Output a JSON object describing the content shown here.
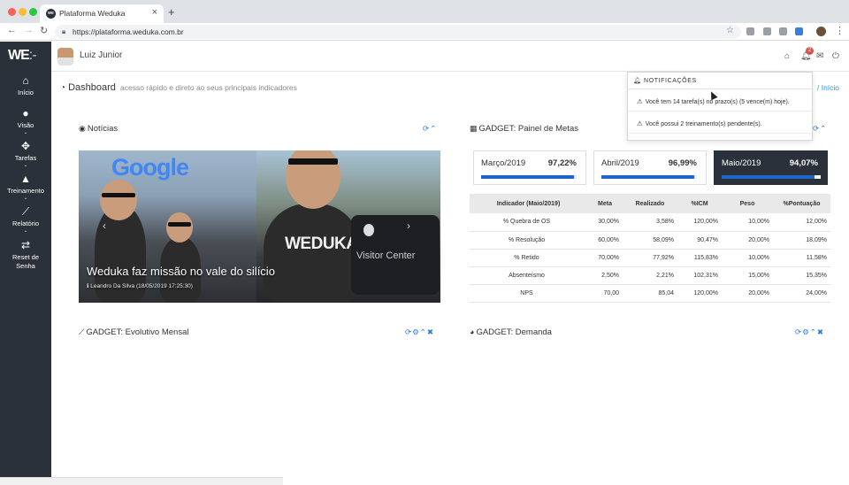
{
  "browser": {
    "tab_title": "Plataforma Weduka",
    "tab_favicon": "we",
    "new_tab": "+",
    "url": "https://plataforma.weduka.com.br"
  },
  "sidebar": {
    "logo": "WE",
    "logo_suffix": ":-",
    "items": [
      {
        "label": "Início",
        "icon": "home-icon",
        "expandable": false
      },
      {
        "label": "Visão",
        "icon": "user-icon",
        "expandable": true
      },
      {
        "label": "Tarefas",
        "icon": "crosshairs-icon",
        "expandable": true
      },
      {
        "label": "Treinamento",
        "icon": "graduation-cap-icon",
        "expandable": true
      },
      {
        "label": "Relatório",
        "icon": "line-chart-icon",
        "expandable": true
      },
      {
        "label": "Reset de Senha",
        "icon": "exchange-icon",
        "expandable": false
      }
    ]
  },
  "topbar": {
    "username": "Luiz Junior",
    "notification_count": "2"
  },
  "header": {
    "title": "Dashboard",
    "subtitle": "acesso rápido e direto ao seus principais indicadores",
    "breadcrumb": "/ Início"
  },
  "notifications": {
    "title": "NOTIFICAÇÕES",
    "items": [
      "Você tem 14 tarefa(s) no prazo(s) (5 vence(m) hoje).",
      "Você possui 2 treinamento(s) pendente(s)."
    ]
  },
  "news": {
    "title": "Notícias",
    "headline": "Weduka faz missão no vale do silício",
    "meta": "Leandro Da Silva (18/05/2019 17:25:30)",
    "photo_text_brand": "Google",
    "photo_text_shirt": "WEDUKA",
    "photo_text_sign": "Visitor Center"
  },
  "metas": {
    "title": "GADGET: Painel de Metas",
    "cards": [
      {
        "month": "Março/2019",
        "value": "97,22%",
        "progress": 0.97,
        "active": false
      },
      {
        "month": "Abril/2019",
        "value": "96,99%",
        "progress": 0.97,
        "active": false
      },
      {
        "month": "Maio/2019",
        "value": "94,07%",
        "progress": 0.94,
        "active": true
      }
    ],
    "columns": [
      "Indicador (Maio/2019)",
      "Meta",
      "Realizado",
      "%ICM",
      "Peso",
      "%Pontuação"
    ],
    "rows": [
      [
        "% Quebra de OS",
        "30,00%",
        "3,58%",
        "120,00%",
        "10,00%",
        "12,00%"
      ],
      [
        "% Resolução",
        "60,00%",
        "58,09%",
        "90,47%",
        "20,00%",
        "18,09%"
      ],
      [
        "% Retido",
        "70,00%",
        "77,92%",
        "115,83%",
        "10,00%",
        "11,58%"
      ],
      [
        "Absenteísmo",
        "2,50%",
        "2,21%",
        "102,31%",
        "15,00%",
        "15,35%"
      ],
      [
        "NPS",
        "70,00",
        "85,04",
        "120,00%",
        "20,00%",
        "24,00%"
      ]
    ]
  },
  "evolutivo": {
    "title": "GADGET: Evolutivo Mensal"
  },
  "demanda": {
    "title": "GADGET: Demanda"
  },
  "colors": {
    "sidebar": "#2b313a",
    "accent": "#2b7bd6",
    "progress": "#1f64c8",
    "badge": "#d9534f"
  }
}
